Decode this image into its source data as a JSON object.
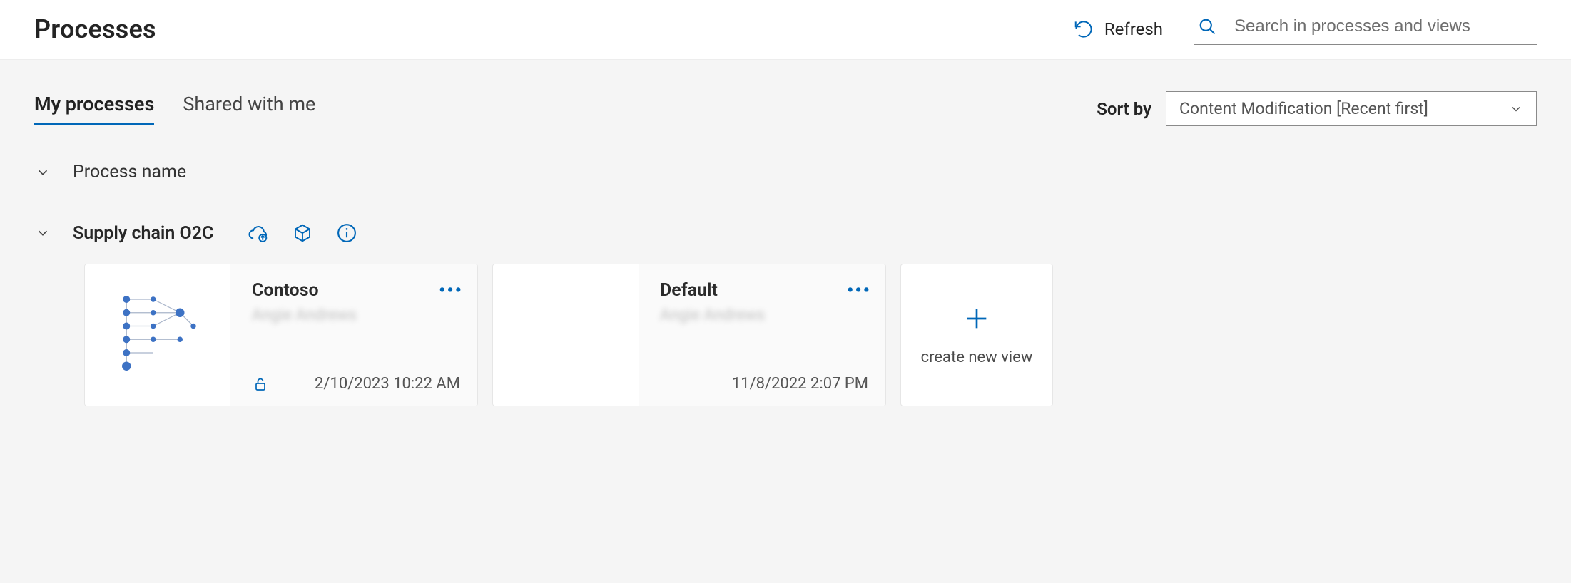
{
  "header": {
    "title": "Processes",
    "refresh_label": "Refresh"
  },
  "search": {
    "placeholder": "Search in processes and views"
  },
  "tabs": {
    "my": "My processes",
    "shared": "Shared with me"
  },
  "sort": {
    "label": "Sort by",
    "value": "Content Modification [Recent first]"
  },
  "columns": {
    "process_name": "Process name"
  },
  "process": {
    "name": "Supply chain O2C",
    "views": [
      {
        "title": "Contoso",
        "owner": "Angie Andrews",
        "timestamp": "2/10/2023 10:22 AM",
        "locked": true
      },
      {
        "title": "Default",
        "owner": "Angie Andrews",
        "timestamp": "11/8/2022 2:07 PM",
        "locked": false
      }
    ]
  },
  "create": {
    "label": "create new view"
  }
}
